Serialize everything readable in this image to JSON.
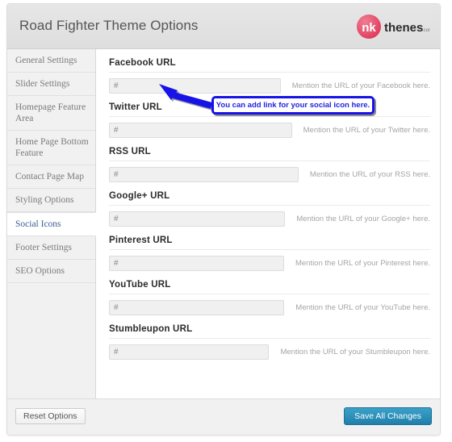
{
  "header": {
    "title": "Road Fighter Theme Options",
    "logo": {
      "name": "inkthemes-logo",
      "mark_text": "nk",
      "word_text": "thenes",
      "suffix_text": ".com",
      "mark_color": "#e8536f",
      "word_color": "#2b2b2b"
    }
  },
  "sidebar": {
    "items": [
      {
        "label": "General Settings",
        "active": false
      },
      {
        "label": "Slider Settings",
        "active": false
      },
      {
        "label": "Homepage Feature Area",
        "active": false
      },
      {
        "label": "Home Page Bottom Feature",
        "active": false
      },
      {
        "label": "Contact Page Map",
        "active": false
      },
      {
        "label": "Styling Options",
        "active": false
      },
      {
        "label": "Social Icons",
        "active": true
      },
      {
        "label": "Footer Settings",
        "active": false
      },
      {
        "label": "SEO Options",
        "active": false
      }
    ]
  },
  "main": {
    "fields": [
      {
        "label": "Facebook URL",
        "value": "#",
        "placeholder": "#",
        "hint": "Mention the URL of your Facebook here."
      },
      {
        "label": "Twitter URL",
        "value": "#",
        "placeholder": "#",
        "hint": "Mention the URL of your Twitter here."
      },
      {
        "label": "RSS URL",
        "value": "#",
        "placeholder": "#",
        "hint": "Mention the URL of your RSS here."
      },
      {
        "label": "Google+ URL",
        "value": "#",
        "placeholder": "#",
        "hint": "Mention the URL of your Google+ here."
      },
      {
        "label": "Pinterest URL",
        "value": "#",
        "placeholder": "#",
        "hint": "Mention the URL of your Pinterest here."
      },
      {
        "label": "YouTube URL",
        "value": "#",
        "placeholder": "#",
        "hint": "Mention the URL of your YouTube here."
      },
      {
        "label": "Stumbleupon URL",
        "value": "#",
        "placeholder": "#",
        "hint": "Mention the URL of your Stumbleupon here."
      }
    ]
  },
  "footer": {
    "reset_label": "Reset Options",
    "save_label": "Save All Changes",
    "save_color": "#2a8ab5"
  },
  "annotation": {
    "callout_text": "You can add link for your social icon here.",
    "color": "#1712e8"
  }
}
